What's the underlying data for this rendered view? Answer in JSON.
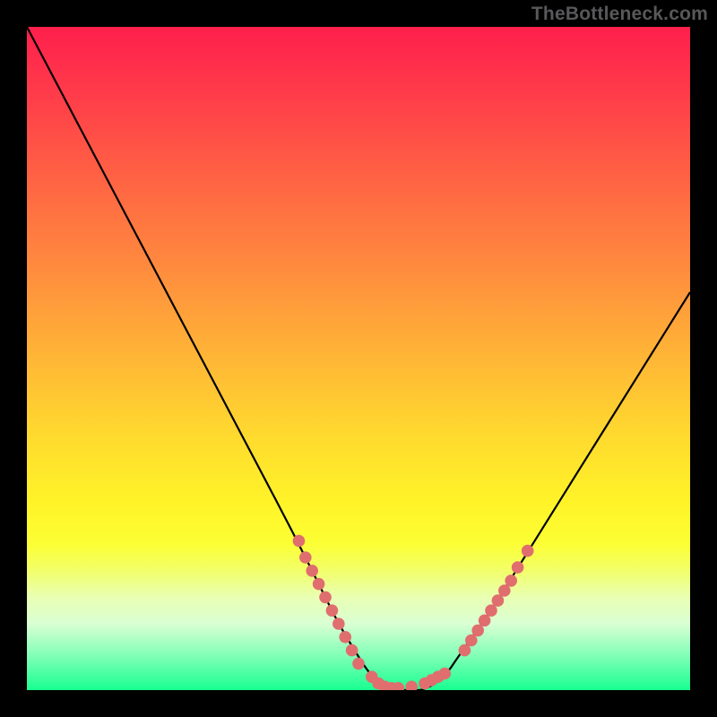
{
  "watermark": "TheBottleneck.com",
  "chart_data": {
    "type": "line",
    "title": "",
    "xlabel": "",
    "ylabel": "",
    "xlim": [
      0,
      100
    ],
    "ylim": [
      0,
      100
    ],
    "grid": false,
    "legend": false,
    "series": [
      {
        "name": "bottleneck-curve",
        "x": [
          0,
          5,
          10,
          15,
          20,
          25,
          30,
          35,
          40,
          45,
          47,
          50,
          52,
          55,
          58,
          60,
          63,
          65,
          70,
          75,
          80,
          85,
          90,
          95,
          100
        ],
        "y": [
          100,
          90.5,
          81,
          71.5,
          62,
          52.5,
          43,
          33.5,
          24,
          14,
          10,
          5,
          2,
          0,
          0,
          0,
          2,
          5,
          12,
          20,
          28,
          36,
          44,
          52,
          60
        ]
      }
    ],
    "markers": [
      {
        "name": "left-red-cluster",
        "points": [
          {
            "x": 41,
            "y": 22.5
          },
          {
            "x": 42,
            "y": 20
          },
          {
            "x": 43,
            "y": 18
          },
          {
            "x": 44,
            "y": 16
          },
          {
            "x": 45,
            "y": 14
          },
          {
            "x": 46,
            "y": 12
          },
          {
            "x": 47,
            "y": 10
          },
          {
            "x": 48,
            "y": 8
          },
          {
            "x": 49,
            "y": 6
          },
          {
            "x": 50,
            "y": 4
          }
        ]
      },
      {
        "name": "bottom-red-cluster",
        "points": [
          {
            "x": 52,
            "y": 2
          },
          {
            "x": 53,
            "y": 1
          },
          {
            "x": 54,
            "y": 0.5
          },
          {
            "x": 55,
            "y": 0.3
          },
          {
            "x": 56,
            "y": 0.3
          },
          {
            "x": 58,
            "y": 0.5
          },
          {
            "x": 60,
            "y": 1
          },
          {
            "x": 61,
            "y": 1.5
          },
          {
            "x": 62,
            "y": 2
          },
          {
            "x": 63,
            "y": 2.5
          }
        ]
      },
      {
        "name": "right-red-cluster",
        "points": [
          {
            "x": 66,
            "y": 6
          },
          {
            "x": 67,
            "y": 7.5
          },
          {
            "x": 68,
            "y": 9
          },
          {
            "x": 69,
            "y": 10.5
          },
          {
            "x": 70,
            "y": 12
          },
          {
            "x": 71,
            "y": 13.5
          },
          {
            "x": 72,
            "y": 15
          },
          {
            "x": 73,
            "y": 16.5
          },
          {
            "x": 74,
            "y": 18.5
          },
          {
            "x": 75.5,
            "y": 21
          }
        ]
      }
    ],
    "colors": {
      "curve": "#000000",
      "marker": "#e06e6e",
      "gradient_top": "#ff1f4c",
      "gradient_bottom": "#18ff91"
    }
  }
}
